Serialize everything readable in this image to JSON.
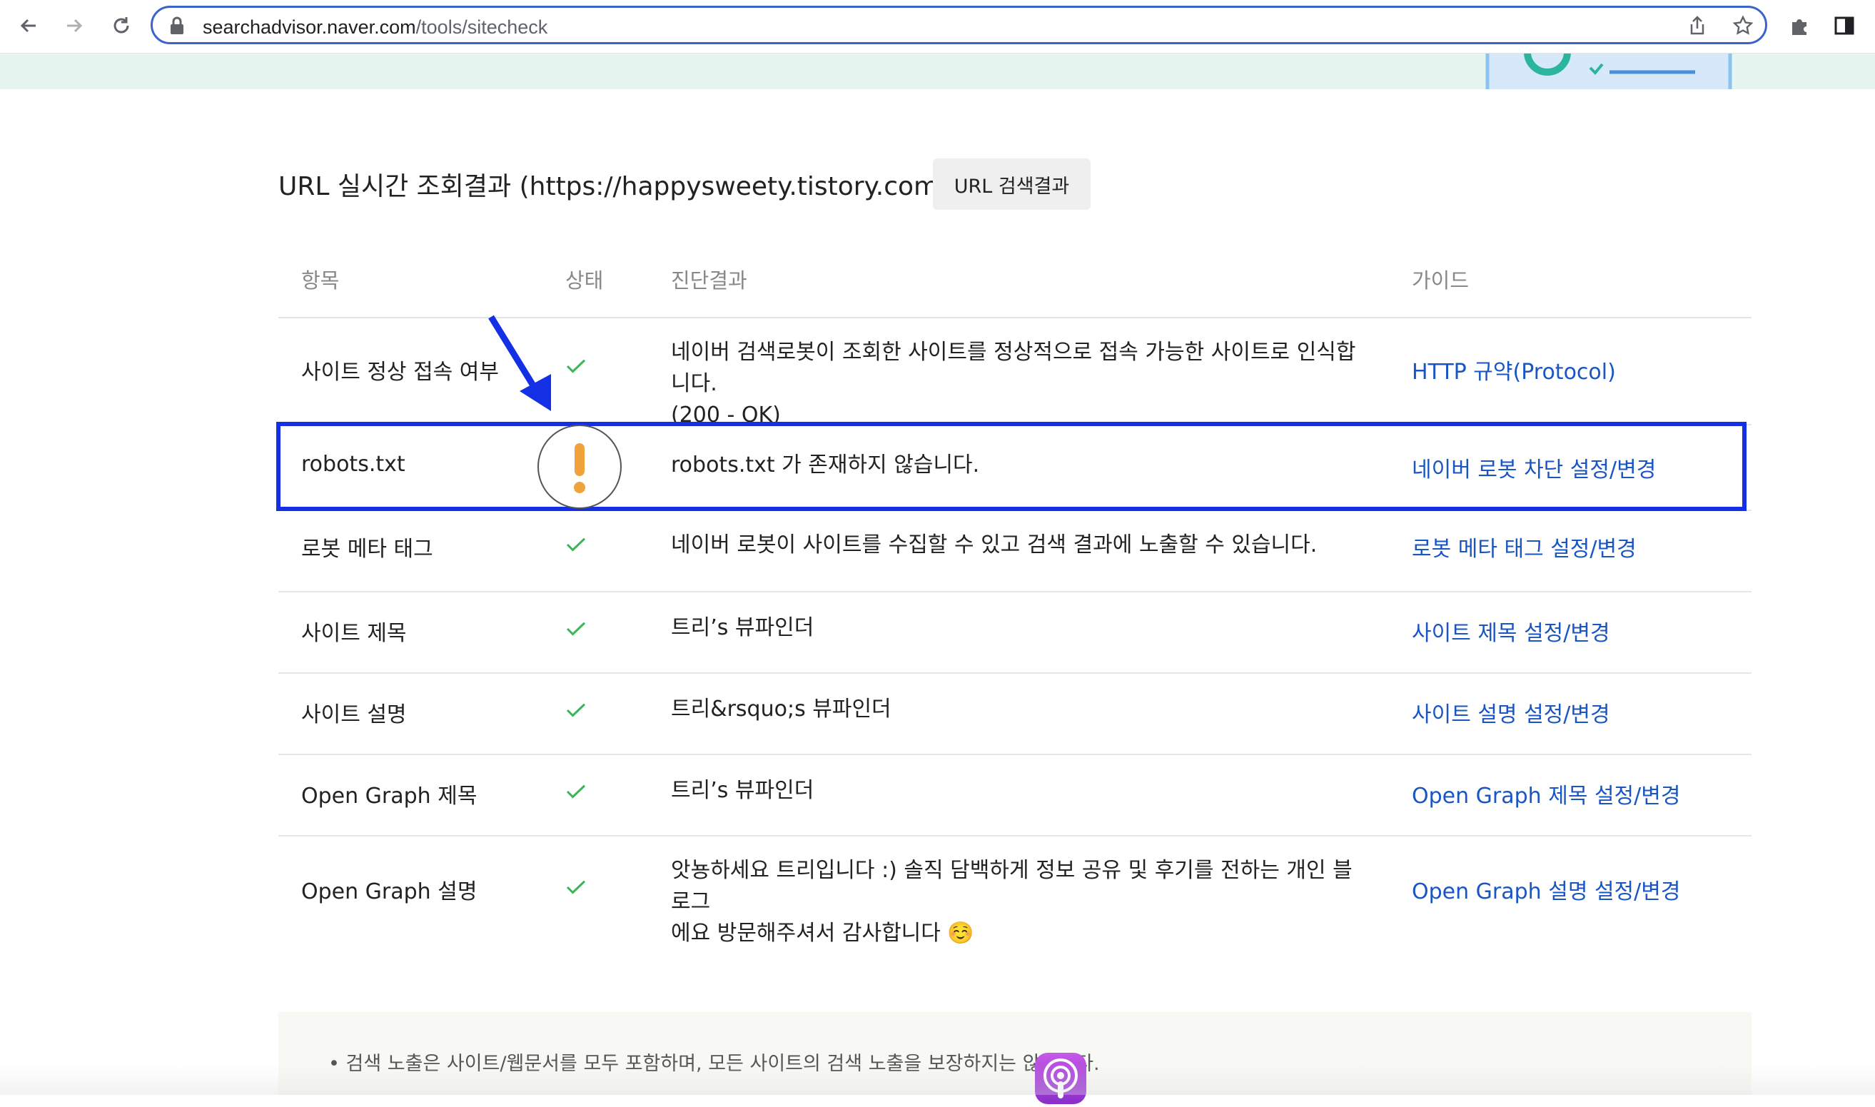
{
  "browser": {
    "url_host": "searchadvisor.naver.com",
    "url_path": "/tools/sitecheck",
    "icons": [
      "back-icon",
      "forward-icon",
      "reload-icon",
      "lock-icon",
      "share-icon",
      "bookmark-star-icon",
      "extensions-icon",
      "sidepanel-icon"
    ]
  },
  "section": {
    "title": "URL 실시간 조회결과 (https://happysweety.tistory.com/)",
    "search_button": "URL 검색결과"
  },
  "table": {
    "headers": {
      "item": "항목",
      "status": "상태",
      "result": "진단결과",
      "guide": "가이드"
    },
    "rows": [
      {
        "item": "사이트 정상 접속 여부",
        "status": "ok",
        "result": "네이버 검색로봇이 조회한 사이트를 정상적으로 접속 가능한 사이트로 인식합니다.",
        "result2": "(200 - OK)",
        "guide": "HTTP 규약(Protocol)"
      },
      {
        "item": "robots.txt",
        "status": "warning",
        "result": "robots.txt 가 존재하지 않습니다.",
        "guide": "네이버 로봇 차단 설정/변경"
      },
      {
        "item": "로봇 메타 태그",
        "status": "ok",
        "result": "네이버 로봇이 사이트를 수집할 수 있고 검색 결과에 노출할 수 있습니다.",
        "guide": "로봇 메타 태그 설정/변경"
      },
      {
        "item": "사이트 제목",
        "status": "ok",
        "result": "트리’s 뷰파인더",
        "guide": "사이트 제목 설정/변경"
      },
      {
        "item": "사이트 설명",
        "status": "ok",
        "result": "트리&rsquo;s 뷰파인더",
        "guide": "사이트 설명 설정/변경"
      },
      {
        "item": "Open Graph 제목",
        "status": "ok",
        "result": "트리’s 뷰파인더",
        "guide": "Open Graph 제목 설정/변경"
      },
      {
        "item": "Open Graph 설명",
        "status": "ok",
        "result": "앗뇽하세요 트리입니다 :) 솔직 담백하게 정보 공유 및 후기를 전하는 개인 블로그",
        "result2": "에요 방문해주셔서 감사합니다 ☺️",
        "guide": "Open Graph 설명 설정/변경"
      }
    ]
  },
  "notice": {
    "text": "검색 노출은 사이트/웹문서를 모두 포함하며, 모든 사이트의 검색 노출을 보장하지는 않습니다."
  },
  "colors": {
    "accent_blue": "#1330e5",
    "link": "#1a55c4",
    "check_green": "#3cb55a",
    "warn_orange": "#f0a33a"
  }
}
